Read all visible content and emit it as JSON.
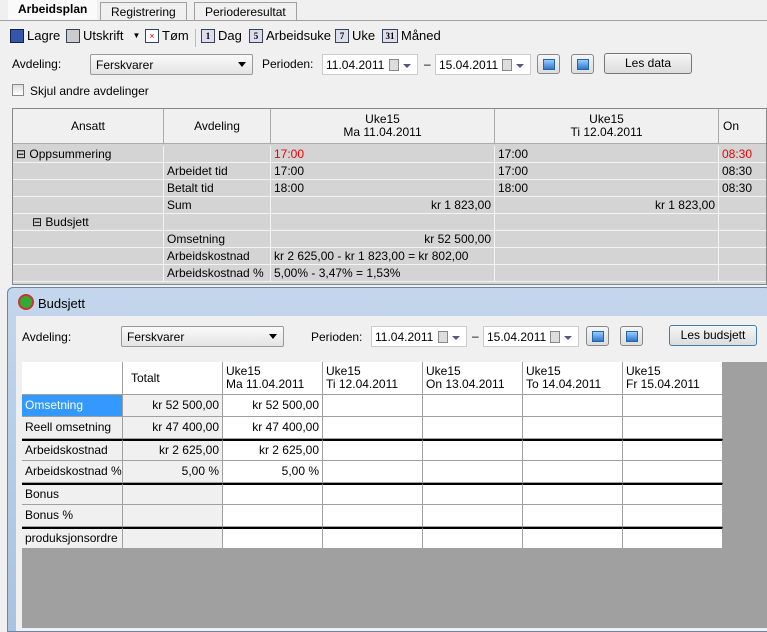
{
  "tabs": [
    "Arbeidsplan",
    "Registrering",
    "Perioderesultat"
  ],
  "toolbar": {
    "save": "Lagre",
    "print": "Utskrift",
    "clear": "Tøm",
    "day": "Dag",
    "workweek": "Arbeidsuke",
    "week": "Uke",
    "month": "Måned",
    "day_icon": "1",
    "workweek_icon": "5",
    "week_icon": "7",
    "month_icon": "31"
  },
  "filter": {
    "dept_label": "Avdeling:",
    "dept_value": "Ferskvarer",
    "period_label": "Perioden:",
    "from": "11.04.2011",
    "dash": "–",
    "to": "15.04.2011",
    "load": "Les data",
    "hide_other": "Skjul andre avdelinger",
    "hide_other_checked": false
  },
  "grid": {
    "headers": [
      "Ansatt",
      "Avdeling",
      "Uke15\nMa 11.04.2011",
      "Uke15\nTi 12.04.2011",
      "On"
    ],
    "rows": [
      {
        "ansatt": "Oppsummering",
        "avd": "",
        "c1": "17:00",
        "c2": "17:00",
        "c3": "08:30",
        "red": true,
        "expander": true,
        "level": 0
      },
      {
        "ansatt": "",
        "avd": "Arbeidet tid",
        "c1": "17:00",
        "c2": "17:00",
        "c3": "08:30"
      },
      {
        "ansatt": "",
        "avd": "Betalt tid",
        "c1": "18:00",
        "c2": "18:00",
        "c3": "08:30"
      },
      {
        "ansatt": "",
        "avd": "Sum",
        "c1": "kr 1 823,00",
        "c2": "kr 1 823,00",
        "c3": "",
        "right": true
      },
      {
        "ansatt": "Budsjett",
        "avd": "",
        "c1": "",
        "c2": "",
        "c3": "",
        "expander": true,
        "level": 1
      },
      {
        "ansatt": "",
        "avd": "Omsetning",
        "c1": "kr 52 500,00",
        "c2": "",
        "c3": "",
        "right": true
      },
      {
        "ansatt": "",
        "avd": "Arbeidskostnad",
        "c1": "kr 2 625,00 - kr 1 823,00 = kr 802,00",
        "c2": "",
        "c3": ""
      },
      {
        "ansatt": "",
        "avd": "Arbeidskostnad %",
        "c1": "5,00% - 3,47% = 1,53%",
        "c2": "",
        "c3": ""
      }
    ]
  },
  "budget": {
    "title": "Budsjett",
    "dept_label": "Avdeling:",
    "dept_value": "Ferskvarer",
    "period_label": "Perioden:",
    "from": "11.04.2011",
    "dash": "–",
    "to": "15.04.2011",
    "load": "Les budsjett",
    "headers": [
      "",
      "Totalt",
      "Uke15\nMa 11.04.2011",
      "Uke15\nTi 12.04.2011",
      "Uke15\nOn 13.04.2011",
      "Uke15\nTo 14.04.2011",
      "Uke15\nFr 15.04.2011"
    ],
    "rows": [
      [
        "Omsetning",
        "kr 52 500,00",
        "kr 52 500,00",
        "",
        "",
        "",
        ""
      ],
      [
        "Reell omsetning",
        "kr 47 400,00",
        "kr 47 400,00",
        "",
        "",
        "",
        ""
      ],
      [
        "Arbeidskostnad",
        "kr 2 625,00",
        "kr 2 625,00",
        "",
        "",
        "",
        ""
      ],
      [
        "Arbeidskostnad %",
        "5,00 %",
        "5,00 %",
        "",
        "",
        "",
        ""
      ],
      [
        "Bonus",
        "",
        "",
        "",
        "",
        "",
        ""
      ],
      [
        "Bonus %",
        "",
        "",
        "",
        "",
        "",
        ""
      ],
      [
        "produksjonsordre",
        "",
        "",
        "",
        "",
        "",
        ""
      ]
    ],
    "selected_row": 0,
    "accent": "#3399ff"
  }
}
